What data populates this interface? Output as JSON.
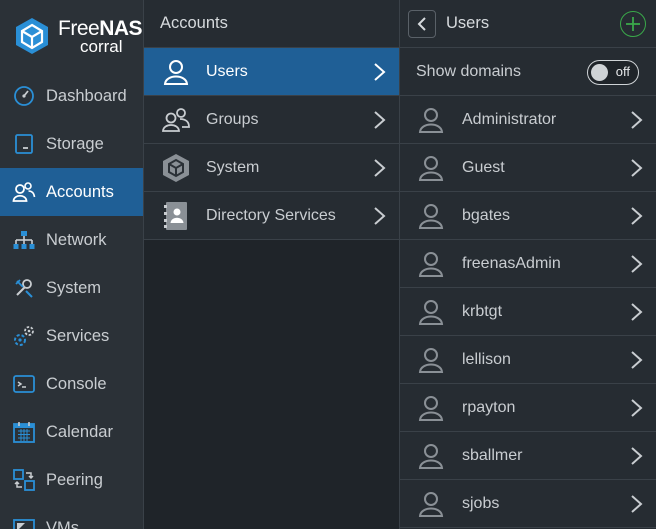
{
  "brand": {
    "name_light": "Free",
    "name_bold": "NAS",
    "sub": "corral",
    "accent": "#1f5f96"
  },
  "nav": {
    "items": [
      {
        "label": "Dashboard",
        "icon": "dashboard-icon"
      },
      {
        "label": "Storage",
        "icon": "storage-icon"
      },
      {
        "label": "Accounts",
        "icon": "accounts-icon",
        "active": true
      },
      {
        "label": "Network",
        "icon": "network-icon"
      },
      {
        "label": "System",
        "icon": "system-icon"
      },
      {
        "label": "Services",
        "icon": "services-icon"
      },
      {
        "label": "Console",
        "icon": "console-icon"
      },
      {
        "label": "Calendar",
        "icon": "calendar-icon"
      },
      {
        "label": "Peering",
        "icon": "peering-icon"
      },
      {
        "label": "VMs",
        "icon": "vms-icon"
      }
    ]
  },
  "accounts": {
    "title": "Accounts",
    "items": [
      {
        "label": "Users",
        "icon": "user-icon",
        "active": true
      },
      {
        "label": "Groups",
        "icon": "groups-icon"
      },
      {
        "label": "System",
        "icon": "system-box-icon"
      },
      {
        "label": "Directory Services",
        "icon": "directory-icon"
      }
    ]
  },
  "users": {
    "title": "Users",
    "show_domains_label": "Show domains",
    "toggle_state": "off",
    "add_color": "#3aa84a",
    "list": [
      "Administrator",
      "Guest",
      "bgates",
      "freenasAdmin",
      "krbtgt",
      "lellison",
      "rpayton",
      "sballmer",
      "sjobs"
    ]
  }
}
